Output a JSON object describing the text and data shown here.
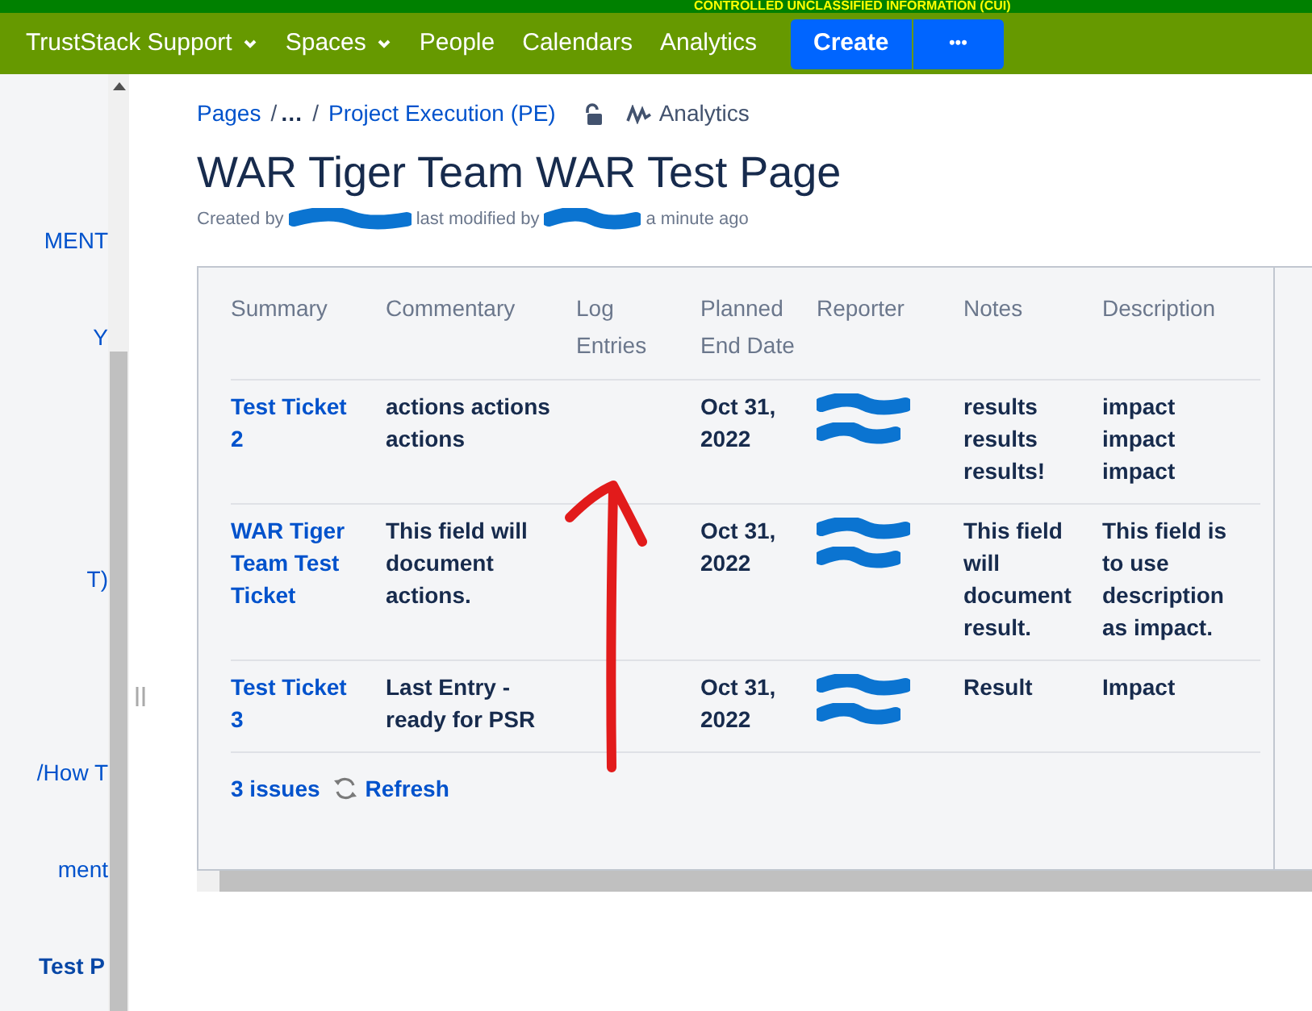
{
  "banner": {
    "text": "CONTROLLED UNCLASSIFIED INFORMATION (CUI)"
  },
  "nav": {
    "items": [
      {
        "label": "TrustStack Support",
        "dropdown": true
      },
      {
        "label": "Spaces",
        "dropdown": true
      },
      {
        "label": "People",
        "dropdown": false
      },
      {
        "label": "Calendars",
        "dropdown": false
      },
      {
        "label": "Analytics",
        "dropdown": false
      }
    ],
    "create": "Create",
    "more": "•••"
  },
  "sidebar": {
    "items": [
      {
        "label": "MENT",
        "selected": false
      },
      {
        "label": "Y",
        "selected": false
      },
      {
        "label": "T)",
        "selected": false
      },
      {
        "label": "/How T",
        "selected": false
      },
      {
        "label": "ment",
        "selected": false
      },
      {
        "label": "Test P",
        "selected": true
      }
    ]
  },
  "breadcrumbs": {
    "items": [
      "Pages",
      "…",
      "Project Execution (PE)"
    ],
    "separator": "/",
    "analytics": "Analytics"
  },
  "page": {
    "title": "WAR Tiger Team WAR Test Page",
    "created_by": "Created by",
    "last_modified_by": "last modified by",
    "time": "a minute ago"
  },
  "table": {
    "columns": [
      "Summary",
      "Commentary",
      "Log Entries",
      "Planned End Date",
      "Reporter",
      "Notes",
      "Description"
    ],
    "rows": [
      {
        "summary": "Test Ticket 2",
        "commentary": "actions actions actions",
        "planned_end_date": "Oct 31, 2022",
        "notes": "results results results!",
        "description": "impact impact impact"
      },
      {
        "summary": "WAR Tiger Team Test Ticket",
        "commentary": "This field will document actions.",
        "planned_end_date": "Oct 31, 2022",
        "notes": "This field will document result.",
        "description": "This field is to use description as impact."
      },
      {
        "summary": "Test Ticket 3",
        "commentary": "Last Entry - ready for PSR",
        "planned_end_date": "Oct 31, 2022",
        "notes": "Result",
        "description": "Impact"
      }
    ],
    "count": "3 issues",
    "refresh": "Refresh"
  }
}
